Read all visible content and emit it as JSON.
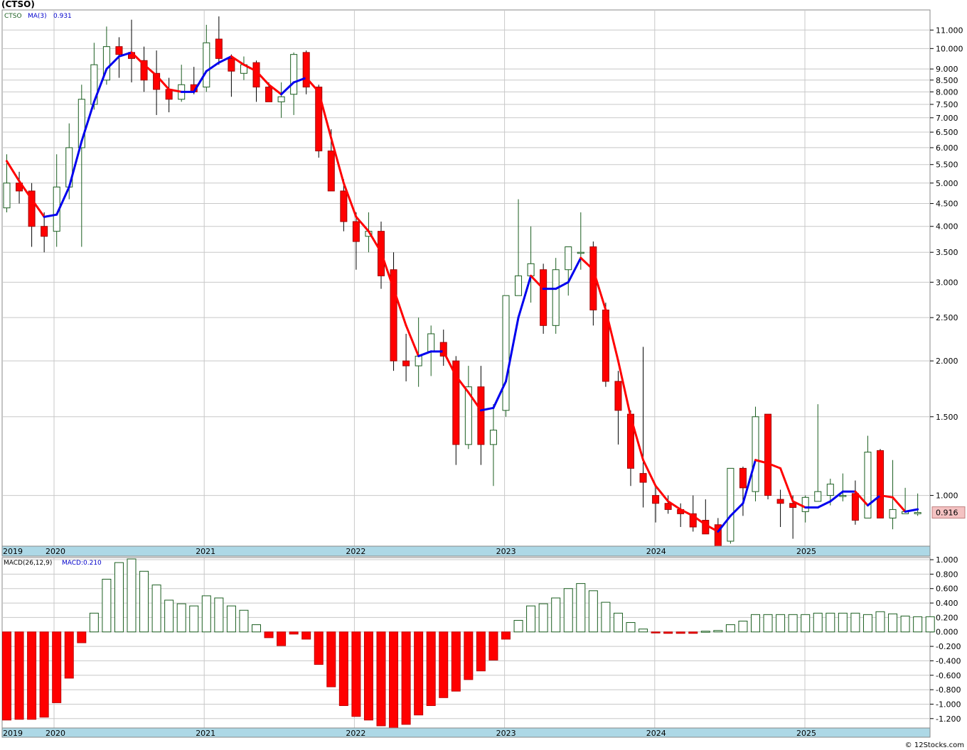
{
  "title": "(CTSO)",
  "footer": "© 12Stocks.com",
  "colors": {
    "up": "#1b5e20",
    "down": "#ff0000",
    "ma_up": "#0000ee",
    "ma_down": "#ff0000",
    "grid": "#c8c8c8",
    "axis_band": "#add8e6",
    "price_tag_bg": "#f4c2c2"
  },
  "price_legend": {
    "symbol": "CTSO",
    "ma_label": "MA(3)",
    "ma_value": "0.931"
  },
  "macd_legend": {
    "label": "MACD(26,12,9)",
    "value": "MACD:0.210"
  },
  "last_price_tag": "0.916",
  "x_labels": [
    "2019",
    "2020",
    "2021",
    "2022",
    "2023",
    "2024",
    "2025"
  ],
  "chart_data": [
    {
      "type": "candlestick",
      "scale": "log",
      "interval": "monthly",
      "start": "2019-12",
      "y_ticks": [
        "11.000",
        "10.000",
        "9.000",
        "8.500",
        "8.000",
        "7.500",
        "7.000",
        "6.500",
        "6.000",
        "5.500",
        "5.000",
        "4.500",
        "4.000",
        "3.500",
        "3.000",
        "2.500",
        "2.000",
        "1.500",
        "1.000"
      ],
      "ylim": [
        0.77,
        12.2
      ],
      "candles": [
        [
          4.4,
          5.8,
          4.3,
          5.0
        ],
        [
          5.0,
          5.3,
          4.5,
          4.8
        ],
        [
          4.8,
          5.0,
          3.6,
          4.0
        ],
        [
          4.0,
          4.3,
          3.5,
          3.8
        ],
        [
          3.9,
          5.8,
          3.6,
          4.9
        ],
        [
          4.9,
          6.8,
          4.6,
          6.0
        ],
        [
          6.0,
          8.3,
          3.6,
          7.7
        ],
        [
          7.5,
          10.3,
          7.3,
          9.2
        ],
        [
          8.5,
          11.2,
          8.3,
          10.1
        ],
        [
          10.1,
          10.6,
          8.6,
          9.7
        ],
        [
          9.8,
          11.6,
          8.4,
          9.5
        ],
        [
          9.4,
          10.1,
          8.0,
          8.5
        ],
        [
          8.8,
          9.9,
          7.1,
          8.1
        ],
        [
          8.1,
          8.6,
          7.2,
          7.7
        ],
        [
          7.7,
          9.2,
          7.6,
          8.3
        ],
        [
          8.3,
          9.1,
          7.9,
          8.0
        ],
        [
          8.2,
          11.3,
          8.0,
          10.3
        ],
        [
          10.5,
          11.8,
          9.2,
          9.5
        ],
        [
          9.5,
          9.7,
          7.8,
          8.9
        ],
        [
          8.8,
          9.6,
          8.5,
          9.2
        ],
        [
          9.3,
          9.4,
          7.6,
          8.2
        ],
        [
          8.2,
          8.4,
          7.6,
          7.6
        ],
        [
          7.6,
          8.4,
          7.0,
          7.8
        ],
        [
          7.9,
          9.8,
          7.1,
          9.7
        ],
        [
          9.8,
          9.9,
          7.9,
          8.2
        ],
        [
          8.2,
          8.3,
          5.7,
          5.9
        ],
        [
          5.9,
          6.6,
          4.8,
          4.8
        ],
        [
          4.8,
          5.1,
          3.9,
          4.1
        ],
        [
          4.1,
          4.3,
          3.2,
          3.7
        ],
        [
          3.8,
          4.3,
          3.5,
          3.9
        ],
        [
          3.9,
          4.1,
          2.9,
          3.1
        ],
        [
          3.2,
          3.5,
          1.9,
          2.0
        ],
        [
          2.0,
          2.3,
          1.8,
          1.95
        ],
        [
          1.95,
          2.5,
          1.75,
          2.05
        ],
        [
          2.1,
          2.4,
          1.85,
          2.3
        ],
        [
          2.2,
          2.35,
          1.95,
          2.05
        ],
        [
          2.0,
          2.05,
          1.17,
          1.3
        ],
        [
          1.3,
          1.95,
          1.27,
          1.75
        ],
        [
          1.75,
          1.95,
          1.17,
          1.3
        ],
        [
          1.3,
          1.6,
          1.05,
          1.4
        ],
        [
          1.55,
          2.8,
          1.5,
          2.8
        ],
        [
          2.8,
          4.6,
          2.9,
          3.1
        ],
        [
          3.1,
          4.0,
          2.7,
          3.3
        ],
        [
          3.2,
          3.3,
          2.3,
          2.4
        ],
        [
          2.4,
          3.4,
          2.3,
          3.2
        ],
        [
          3.2,
          3.6,
          2.8,
          3.6
        ],
        [
          3.5,
          4.3,
          3.2,
          3.5
        ],
        [
          3.6,
          3.7,
          2.4,
          2.6
        ],
        [
          2.6,
          2.7,
          1.75,
          1.8
        ],
        [
          1.8,
          1.9,
          1.3,
          1.55
        ],
        [
          1.52,
          1.55,
          1.05,
          1.15
        ],
        [
          1.12,
          2.15,
          0.94,
          1.07
        ],
        [
          1.0,
          1.05,
          0.87,
          0.96
        ],
        [
          0.96,
          1.0,
          0.91,
          0.93
        ],
        [
          0.93,
          0.96,
          0.85,
          0.91
        ],
        [
          0.91,
          1.0,
          0.83,
          0.85
        ],
        [
          0.88,
          0.98,
          0.84,
          0.82
        ],
        [
          0.86,
          0.89,
          0.78,
          0.77
        ],
        [
          0.79,
          1.15,
          0.78,
          1.15
        ],
        [
          1.15,
          1.16,
          0.9,
          1.04
        ],
        [
          1.02,
          1.58,
          0.97,
          1.5
        ],
        [
          1.52,
          1.52,
          0.98,
          1.0
        ],
        [
          0.98,
          1.03,
          0.85,
          0.96
        ],
        [
          0.96,
          1.0,
          0.8,
          0.94
        ],
        [
          0.92,
          1.0,
          0.87,
          0.99
        ],
        [
          0.97,
          1.6,
          0.97,
          1.02
        ],
        [
          1.0,
          1.09,
          0.95,
          1.06
        ],
        [
          1.0,
          1.12,
          0.97,
          1.0
        ],
        [
          1.01,
          1.08,
          0.86,
          0.88
        ],
        [
          0.89,
          1.36,
          0.89,
          1.25
        ],
        [
          1.26,
          1.27,
          0.89,
          0.89
        ],
        [
          0.89,
          1.2,
          0.84,
          0.93
        ],
        [
          0.91,
          1.04,
          0.91,
          0.92
        ],
        [
          0.91,
          1.01,
          0.9,
          0.916
        ]
      ],
      "ma3": [
        5.6,
        5.05,
        4.6,
        4.2,
        4.25,
        4.9,
        6.2,
        7.6,
        9.0,
        9.6,
        9.8,
        9.2,
        8.7,
        8.1,
        8.0,
        8.0,
        8.9,
        9.3,
        9.6,
        9.2,
        8.9,
        8.3,
        7.9,
        8.4,
        8.6,
        8.0,
        6.3,
        5.0,
        4.2,
        3.9,
        3.5,
        2.9,
        2.4,
        2.05,
        2.1,
        2.1,
        1.85,
        1.7,
        1.55,
        1.57,
        1.8,
        2.5,
        3.1,
        2.9,
        2.9,
        3.0,
        3.4,
        3.2,
        2.6,
        2.0,
        1.5,
        1.2,
        1.05,
        0.97,
        0.93,
        0.9,
        0.86,
        0.83,
        0.9,
        0.96,
        1.2,
        1.18,
        1.15,
        0.97,
        0.94,
        0.94,
        0.97,
        1.02,
        1.02,
        0.95,
        1.0,
        0.99,
        0.92,
        0.931
      ]
    },
    {
      "type": "bar",
      "title": "MACD(26,12,9)",
      "y_ticks": [
        "1.000",
        "0.800",
        "0.600",
        "0.400",
        "0.200",
        "0.000",
        "-0.200",
        "-0.400",
        "-0.600",
        "-0.800",
        "-1.000",
        "-1.200"
      ],
      "ylim": [
        -1.33,
        1.03
      ],
      "values": [
        -1.22,
        -1.21,
        -1.21,
        -1.18,
        -0.98,
        -0.64,
        -0.15,
        0.26,
        0.73,
        0.96,
        1.01,
        0.84,
        0.65,
        0.44,
        0.39,
        0.36,
        0.5,
        0.47,
        0.36,
        0.3,
        0.1,
        -0.08,
        -0.19,
        -0.03,
        -0.1,
        -0.45,
        -0.76,
        -1.02,
        -1.17,
        -1.22,
        -1.3,
        -1.35,
        -1.28,
        -1.15,
        -1.02,
        -0.91,
        -0.82,
        -0.66,
        -0.54,
        -0.39,
        -0.1,
        0.16,
        0.36,
        0.39,
        0.47,
        0.6,
        0.67,
        0.57,
        0.41,
        0.26,
        0.13,
        0.04,
        -0.01,
        -0.02,
        -0.02,
        -0.02,
        0.01,
        0.02,
        0.1,
        0.15,
        0.24,
        0.24,
        0.24,
        0.24,
        0.24,
        0.26,
        0.26,
        0.26,
        0.26,
        0.24,
        0.28,
        0.25,
        0.22,
        0.21,
        0.21
      ]
    }
  ]
}
